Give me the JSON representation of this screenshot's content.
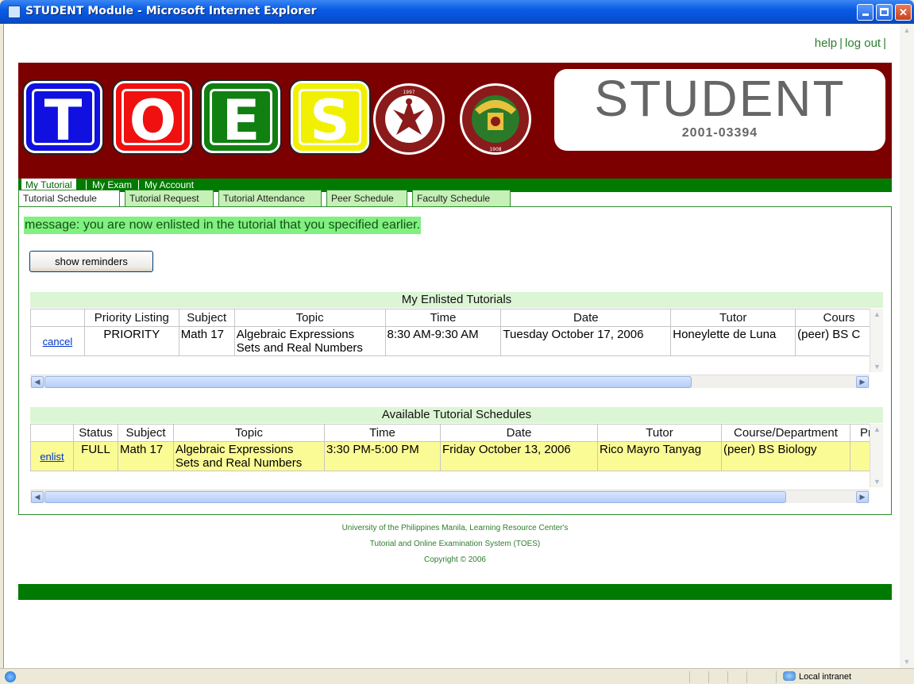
{
  "window": {
    "title": "STUDENT Module - Microsoft Internet Explorer"
  },
  "header": {
    "help": "help",
    "logout": "log out",
    "sep": "|"
  },
  "banner": {
    "letters": [
      "T",
      "O",
      "E",
      "S"
    ],
    "letter_colors": [
      "#1010e0",
      "#f01010",
      "#108010",
      "#f0f000"
    ],
    "role": "STUDENT",
    "student_id": "2001-03394",
    "seal1_year": "1997",
    "seal2_year": "1908"
  },
  "main_nav": {
    "items": [
      "My Tutorial",
      "My Exam",
      "My Account"
    ],
    "active": "My Tutorial"
  },
  "tabs": {
    "items": [
      "Tutorial Schedule",
      "Tutorial Request",
      "Tutorial Attendance",
      "Peer Schedule",
      "Faculty Schedule"
    ],
    "active": "Tutorial Schedule"
  },
  "message": "message: you are now enlisted in the tutorial that you specified earlier.",
  "reminders_button": "show reminders",
  "enlisted": {
    "title": "My Enlisted Tutorials",
    "headers": [
      "",
      "Priority Listing",
      "Subject",
      "Topic",
      "Time",
      "Date",
      "Tutor",
      "Cours"
    ],
    "rows": [
      {
        "action": "cancel",
        "priority": "PRIORITY",
        "subject": "Math 17",
        "topic_line1": "Algebraic Expressions",
        "topic_line2": "Sets and Real Numbers",
        "time": "8:30 AM-9:30 AM",
        "date": "Tuesday October 17, 2006",
        "tutor": "Honeylette de Luna",
        "course": "(peer) BS C"
      }
    ]
  },
  "available": {
    "title": "Available Tutorial Schedules",
    "headers": [
      "",
      "Status",
      "Subject",
      "Topic",
      "Time",
      "Date",
      "Tutor",
      "Course/Department",
      "Pr"
    ],
    "rows": [
      {
        "action": "enlist",
        "status": "FULL",
        "subject": "Math 17",
        "topic_line1": "Algebraic Expressions",
        "topic_line2": "Sets and Real Numbers",
        "time": "3:30 PM-5:00 PM",
        "date": "Friday October 13, 2006",
        "tutor": "Rico Mayro Tanyag",
        "course": "(peer) BS Biology"
      }
    ]
  },
  "footer": {
    "line1": "University of the Philippines Manila, Learning Resource Center's",
    "line2": "Tutorial and Online Examination System (TOES)",
    "line3": "Copyright © 2006"
  },
  "statusbar": {
    "zone": "Local intranet"
  }
}
